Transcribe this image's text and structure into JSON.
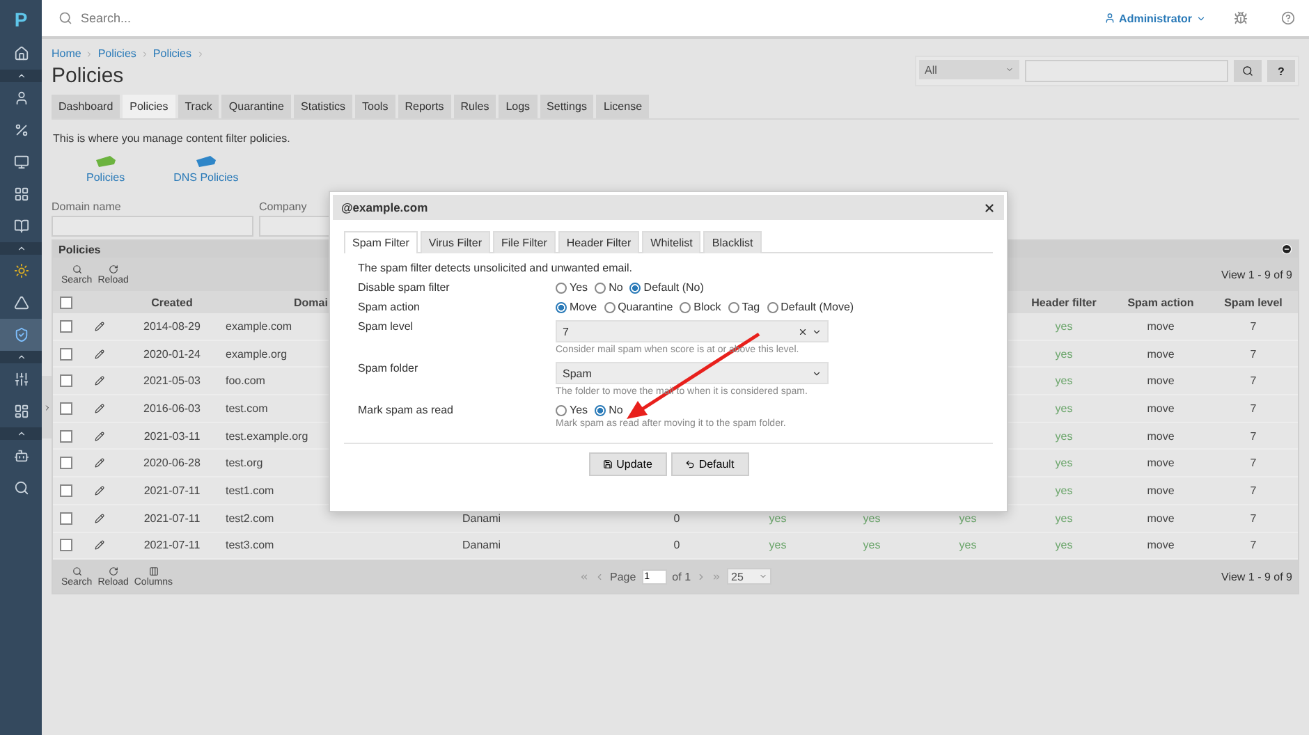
{
  "sidebar": {
    "logo": "P",
    "items": [
      {
        "kind": "item",
        "selected": false
      },
      {
        "kind": "group"
      },
      {
        "kind": "item",
        "selected": false
      },
      {
        "kind": "item",
        "selected": false
      },
      {
        "kind": "item",
        "selected": false
      },
      {
        "kind": "item",
        "selected": false
      },
      {
        "kind": "item",
        "selected": false
      },
      {
        "kind": "group"
      },
      {
        "kind": "item",
        "selected": false
      },
      {
        "kind": "item",
        "selected": false
      },
      {
        "kind": "item",
        "selected": true
      },
      {
        "kind": "group"
      },
      {
        "kind": "item",
        "selected": false
      },
      {
        "kind": "item",
        "selected": false
      },
      {
        "kind": "group"
      },
      {
        "kind": "item",
        "selected": false
      },
      {
        "kind": "item",
        "selected": false
      }
    ]
  },
  "topbar": {
    "search_placeholder": "Search...",
    "user": "Administrator"
  },
  "breadcrumb": [
    "Home",
    "Policies",
    "Policies"
  ],
  "page_title": "Policies",
  "quick_search": {
    "scope": "All",
    "help": "?"
  },
  "tabs": [
    {
      "label": "Dashboard",
      "selected": false
    },
    {
      "label": "Policies",
      "selected": true
    },
    {
      "label": "Track",
      "selected": false
    },
    {
      "label": "Quarantine",
      "selected": false
    },
    {
      "label": "Statistics",
      "selected": false
    },
    {
      "label": "Tools",
      "selected": false
    },
    {
      "label": "Reports",
      "selected": false
    },
    {
      "label": "Rules",
      "selected": false
    },
    {
      "label": "Logs",
      "selected": false
    },
    {
      "label": "Settings",
      "selected": false
    },
    {
      "label": "License",
      "selected": false
    }
  ],
  "description": "This is where you manage content filter policies.",
  "shortcuts": [
    {
      "label": "Policies",
      "color": "#6cb33f"
    },
    {
      "label": "DNS Policies",
      "color": "#2f86c8"
    }
  ],
  "filters": [
    {
      "label": "Domain name"
    },
    {
      "label": "Company"
    }
  ],
  "table": {
    "title": "Policies",
    "toolbar": [
      "Search",
      "Reload"
    ],
    "view": "View 1 - 9 of 9",
    "columns": {
      "created": "Created",
      "domain": "Domai",
      "header_filter": "Header filter",
      "spam_action": "Spam action",
      "spam_level": "Spam level"
    },
    "select_all": {
      "checked": false
    },
    "rows": [
      {
        "checked": false,
        "created": "2014-08-29",
        "domain": "example.com",
        "header_filter": "yes",
        "spam_action": "move",
        "spam_level": "7"
      },
      {
        "checked": false,
        "created": "2020-01-24",
        "domain": "example.org",
        "header_filter": "yes",
        "spam_action": "move",
        "spam_level": "7"
      },
      {
        "checked": false,
        "created": "2021-05-03",
        "domain": "foo.com",
        "header_filter": "yes",
        "spam_action": "move",
        "spam_level": "7"
      },
      {
        "checked": false,
        "created": "2016-06-03",
        "domain": "test.com",
        "header_filter": "yes",
        "spam_action": "move",
        "spam_level": "7"
      },
      {
        "checked": false,
        "created": "2021-03-11",
        "domain": "test.example.org",
        "header_filter": "yes",
        "spam_action": "move",
        "spam_level": "7"
      },
      {
        "checked": false,
        "created": "2020-06-28",
        "domain": "test.org",
        "header_filter": "yes",
        "spam_action": "move",
        "spam_level": "7"
      },
      {
        "checked": false,
        "created": "2021-07-11",
        "domain": "test1.com",
        "header_filter": "yes",
        "spam_action": "move",
        "spam_level": "7"
      },
      {
        "checked": false,
        "created": "2021-07-11",
        "domain": "test2.com",
        "company": "Danami",
        "count": "0",
        "filters": [
          "yes",
          "yes",
          "yes"
        ],
        "header_filter": "yes",
        "spam_action": "move",
        "spam_level": "7"
      },
      {
        "checked": false,
        "created": "2021-07-11",
        "domain": "test3.com",
        "company": "Danami",
        "count": "0",
        "filters": [
          "yes",
          "yes",
          "yes"
        ],
        "header_filter": "yes",
        "spam_action": "move",
        "spam_level": "7"
      }
    ],
    "footer_tools": [
      "Search",
      "Reload",
      "Columns"
    ],
    "pager": {
      "page_label": "Page",
      "page": "1",
      "of": "of 1",
      "page_size": "25"
    },
    "footer_view": "View 1 - 9 of 9"
  },
  "dialog": {
    "title": "@example.com",
    "tabs": [
      {
        "label": "Spam Filter",
        "selected": true
      },
      {
        "label": "Virus Filter",
        "selected": false
      },
      {
        "label": "File Filter",
        "selected": false
      },
      {
        "label": "Header Filter",
        "selected": false
      },
      {
        "label": "Whitelist",
        "selected": false
      },
      {
        "label": "Blacklist",
        "selected": false
      }
    ],
    "intro": "The spam filter detects unsolicited and unwanted email.",
    "fields": [
      {
        "kind": "radio",
        "label": "Disable spam filter",
        "options": [
          {
            "label": "Yes",
            "selected": false
          },
          {
            "label": "No",
            "selected": false
          },
          {
            "label": "Default (No)",
            "selected": true
          }
        ]
      },
      {
        "kind": "radio",
        "label": "Spam action",
        "options": [
          {
            "label": "Move",
            "selected": true
          },
          {
            "label": "Quarantine",
            "selected": false
          },
          {
            "label": "Block",
            "selected": false
          },
          {
            "label": "Tag",
            "selected": false
          },
          {
            "label": "Default (Move)",
            "selected": false
          }
        ]
      },
      {
        "kind": "select",
        "label": "Spam level",
        "value": "7",
        "clearable": true,
        "help": "Consider mail spam when score is at or above this level."
      },
      {
        "kind": "select",
        "label": "Spam folder",
        "value": "Spam",
        "help": "The folder to move the mail to when it is considered spam."
      },
      {
        "kind": "radio",
        "label": "Mark spam as read",
        "options": [
          {
            "label": "Yes",
            "selected": false
          },
          {
            "label": "No",
            "selected": true
          }
        ],
        "help": "Mark spam as read after moving it to the spam folder."
      }
    ],
    "buttons": [
      {
        "kind": "save",
        "label": "Update"
      },
      {
        "kind": "undo",
        "label": "Default"
      }
    ]
  }
}
